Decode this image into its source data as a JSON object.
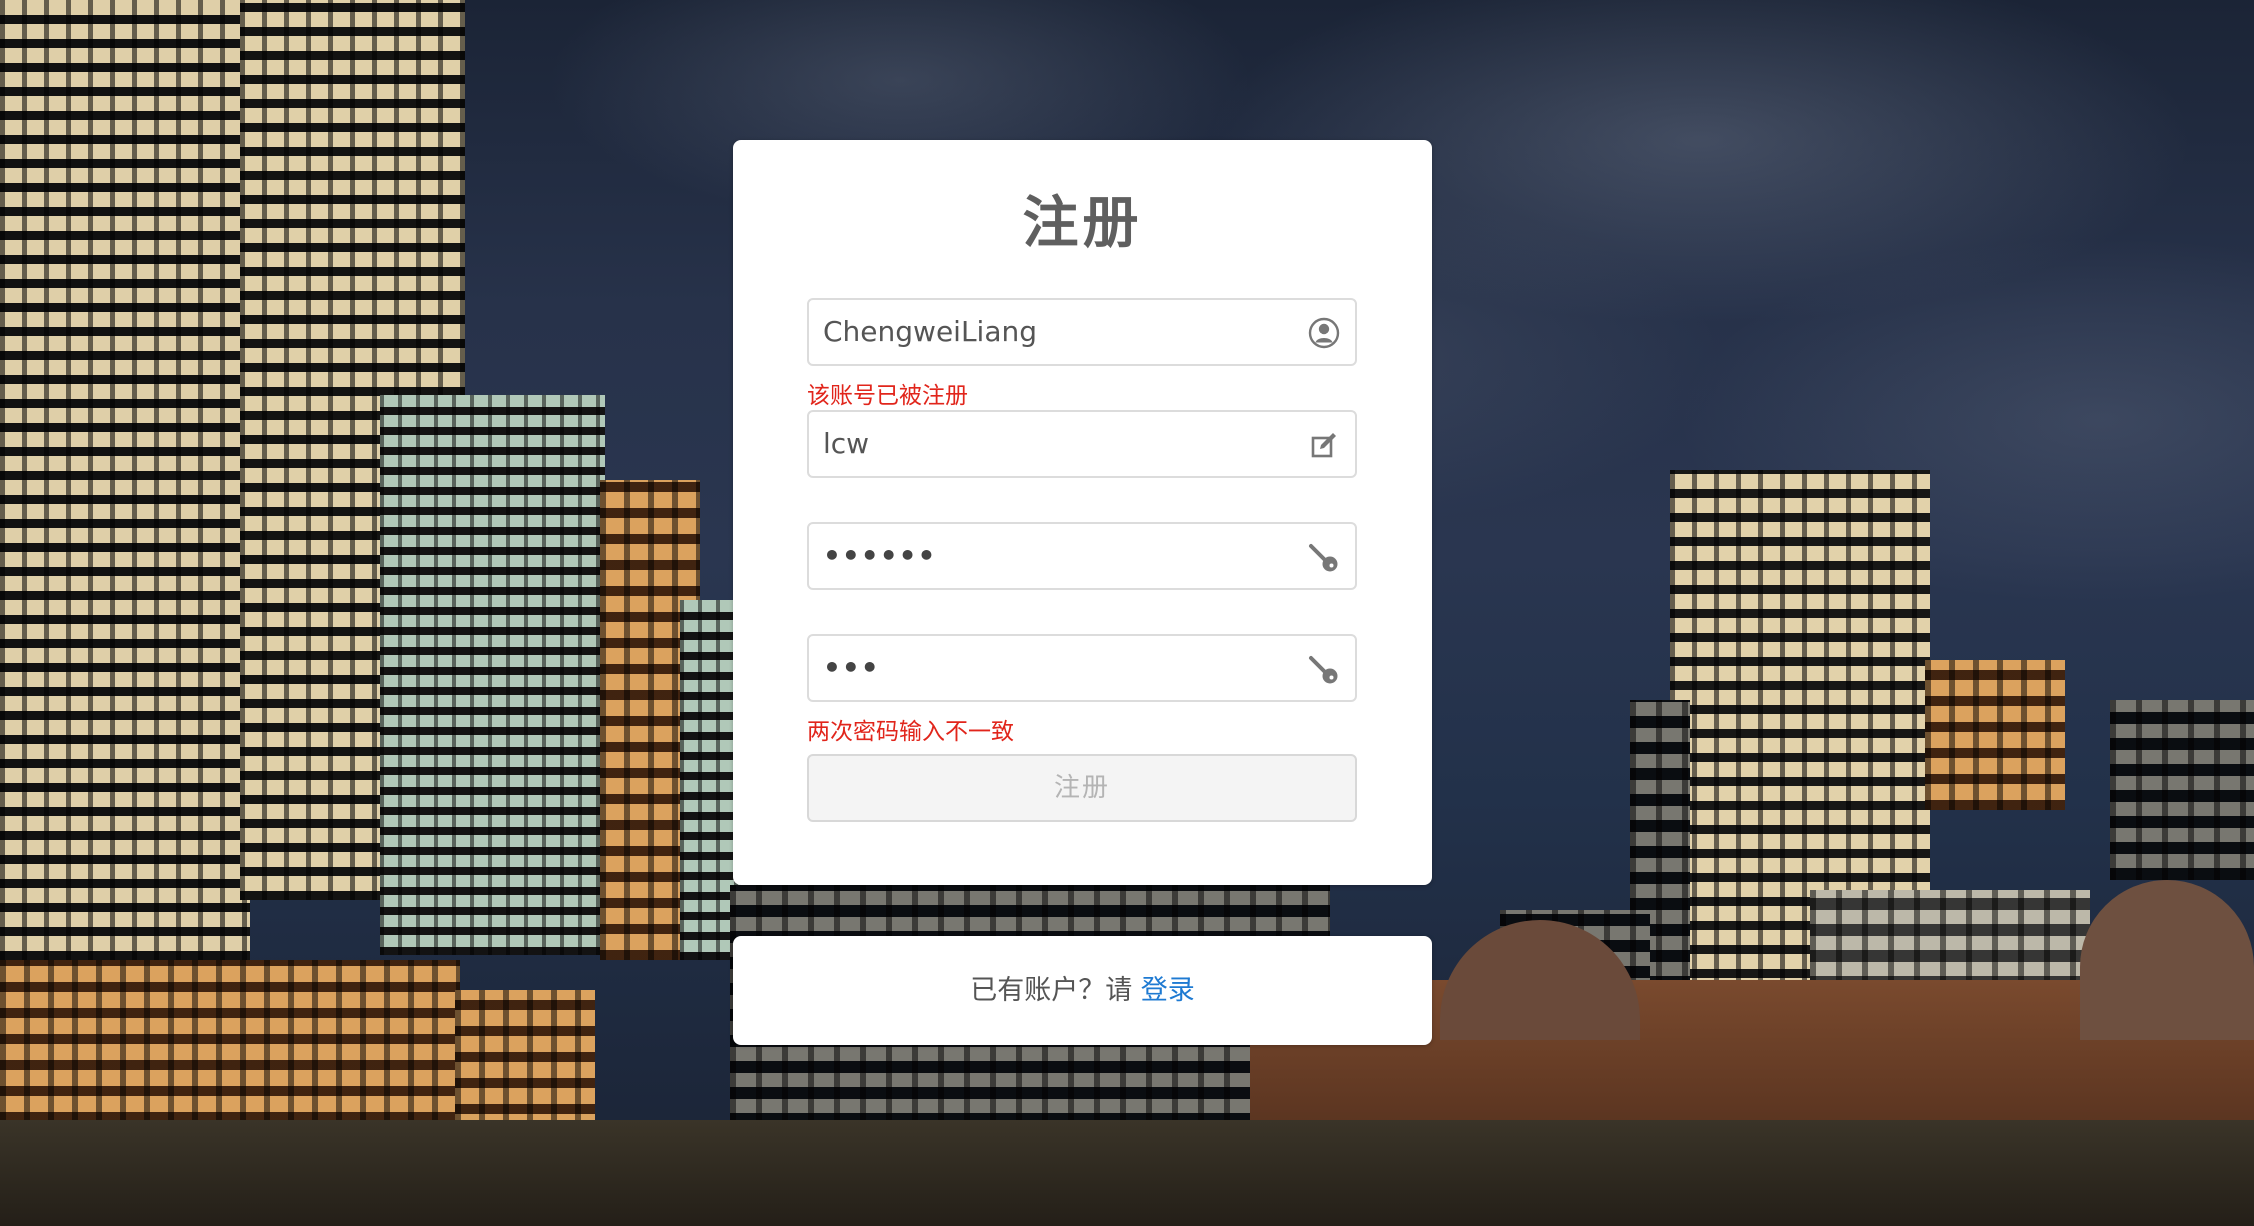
{
  "form": {
    "title": "注册",
    "username_value": "ChengweiLiang",
    "username_error": "该账号已被注册",
    "nickname_value": "lcw",
    "password_value": "••••••",
    "confirm_value": "•••",
    "confirm_error": "两次密码输入不一致",
    "submit_label": "注册"
  },
  "footer": {
    "prompt": "已有账户？请 ",
    "login_link": "登录"
  },
  "icons": {
    "username": "user-icon",
    "nickname": "edit-icon",
    "password": "key-icon",
    "confirm": "key-icon"
  },
  "colors": {
    "error": "#e1251b",
    "link": "#1e7ad2",
    "title": "#5f5f5f"
  }
}
